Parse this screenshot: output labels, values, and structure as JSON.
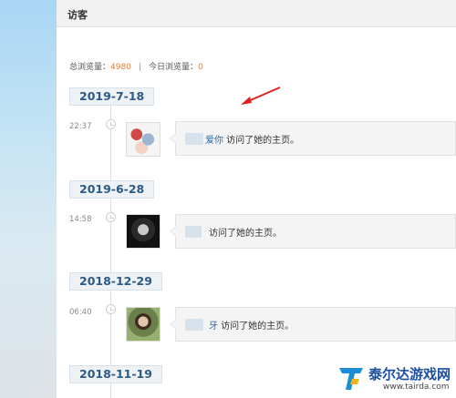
{
  "header": {
    "title": "访客"
  },
  "stats": {
    "total_label": "总浏览量：",
    "total_value": "4980",
    "separator": "|",
    "today_label": "今日浏览量：",
    "today_value": "0"
  },
  "timeline": [
    {
      "date": "2019-7-18",
      "time": "22:37",
      "name_suffix": "爱你",
      "action": " 访问了她的主页。",
      "avatar": "avatar-collage"
    },
    {
      "date": "2019-6-28",
      "time": "14:58",
      "name_suffix": "",
      "action": "访问了她的主页。",
      "avatar": "avatar-man-bw"
    },
    {
      "date": "2018-12-29",
      "time": "06:40",
      "name_suffix": "牙",
      "action": " 访问了她的主页。",
      "avatar": "avatar-boy-outdoor"
    },
    {
      "date": "2018-11-19"
    }
  ],
  "watermark": {
    "title": "泰尔达游戏网",
    "url": "www.tairda.com"
  },
  "colors": {
    "accent_orange": "#f07d2b",
    "date_blue": "#2c5a86",
    "arrow_red": "#e0201c"
  }
}
